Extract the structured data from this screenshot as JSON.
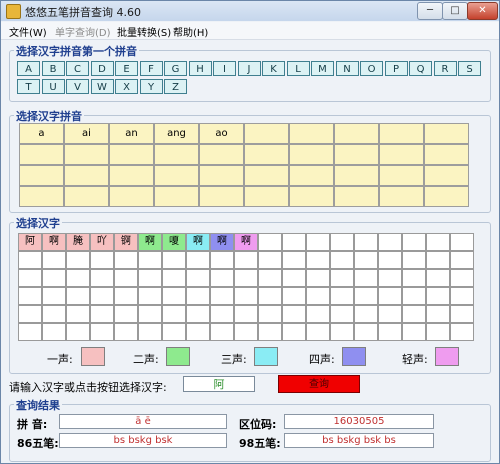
{
  "window": {
    "title": "悠悠五笔拼音查询 4.60",
    "controls": {
      "minimize": "─",
      "maximize": "□",
      "close": "✕"
    }
  },
  "menu": [
    {
      "label": "文件(W)",
      "enabled": true
    },
    {
      "label": "单字查询(D)",
      "enabled": false
    },
    {
      "label": "批量转换(S)",
      "enabled": true
    },
    {
      "label": "帮助(H)",
      "enabled": true
    }
  ],
  "letter_section": {
    "title": "选择汉字拼音第一个拼音",
    "row1": [
      "A",
      "B",
      "C",
      "D",
      "E",
      "F",
      "G",
      "H",
      "I",
      "J",
      "K",
      "L",
      "M",
      "N",
      "O",
      "P",
      "Q",
      "R",
      "S"
    ],
    "row2": [
      "T",
      "U",
      "V",
      "W",
      "X",
      "Y",
      "Z"
    ]
  },
  "pinyin_section": {
    "title": "选择汉字拼音",
    "values": [
      "a",
      "ai",
      "an",
      "ang",
      "ao"
    ]
  },
  "hanzi_section": {
    "title": "选择汉字",
    "cells": [
      {
        "text": "阿",
        "tone": 1
      },
      {
        "text": "啊",
        "tone": 1
      },
      {
        "text": "腌",
        "tone": 1
      },
      {
        "text": "吖",
        "tone": 1
      },
      {
        "text": "锕",
        "tone": 1
      },
      {
        "text": "啊",
        "tone": 2
      },
      {
        "text": "嗄",
        "tone": 2
      },
      {
        "text": "啊",
        "tone": 3
      },
      {
        "text": "啊",
        "tone": 4
      },
      {
        "text": "啊",
        "tone": 5
      }
    ]
  },
  "tones": {
    "labels": [
      "一声:",
      "二声:",
      "三声:",
      "四声:",
      "轻声:"
    ],
    "colors": [
      "#f6c0c0",
      "#8eea8e",
      "#8aecf4",
      "#8f8ff0",
      "#ef9cef"
    ]
  },
  "input": {
    "prompt": "请输入汉字或点击按钮选择汉字:",
    "value": "阿",
    "button_label": "查询"
  },
  "results": {
    "title": "查询结果",
    "pinyin_label": "拼  音:",
    "pinyin_value": "ā  ē",
    "quwei_label": "区位码:",
    "quwei_value": "16030505",
    "wubi86_label": "86五笔:",
    "wubi86_value": "bs  bskg  bsk",
    "wubi98_label": "98五笔:",
    "wubi98_value": "bs  bskg  bsk  bs"
  }
}
